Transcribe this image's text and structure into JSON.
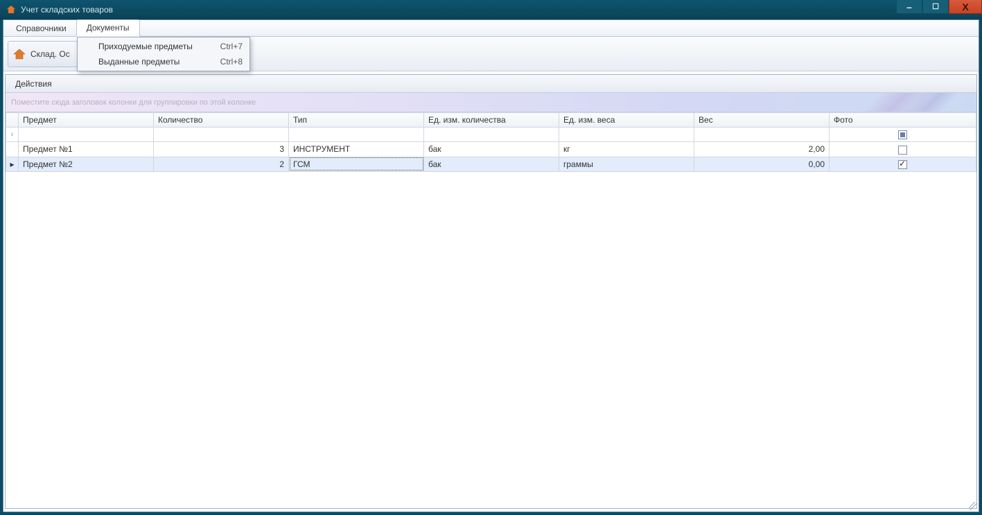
{
  "window": {
    "title": "Учет складских товаров"
  },
  "menu": {
    "tabs": [
      {
        "label": "Справочники"
      },
      {
        "label": "Документы"
      }
    ],
    "active_index": 1,
    "dropdown": [
      {
        "label": "Приходуемые предметы",
        "shortcut": "Ctrl+7"
      },
      {
        "label": "Выданные предметы",
        "shortcut": "Ctrl+8"
      }
    ]
  },
  "ribbon": {
    "button_label": "Склад. Ос"
  },
  "subwindow": {
    "actions_label": "Действия",
    "group_hint": "Поместите сюда заголовок колонки для группировки по этой колонке"
  },
  "grid": {
    "columns": [
      {
        "header": "Предмет"
      },
      {
        "header": "Количество"
      },
      {
        "header": "Тип"
      },
      {
        "header": "Ед. изм. количества"
      },
      {
        "header": "Ед. изм. веса"
      },
      {
        "header": "Вес"
      },
      {
        "header": "Фото"
      }
    ],
    "rows": [
      {
        "predmet": "Предмет №1",
        "kolichestvo": "3",
        "tip": "ИНСТРУМЕНТ",
        "ed_kol": "бак",
        "ed_ves": "кг",
        "ves": "2,00",
        "foto_checked": false,
        "selected": false
      },
      {
        "predmet": "Предмет №2",
        "kolichestvo": "2",
        "tip": "ГСМ",
        "ed_kol": "бак",
        "ed_ves": "граммы",
        "ves": "0,00",
        "foto_checked": true,
        "selected": true
      }
    ],
    "filter_icon": "⌕"
  }
}
